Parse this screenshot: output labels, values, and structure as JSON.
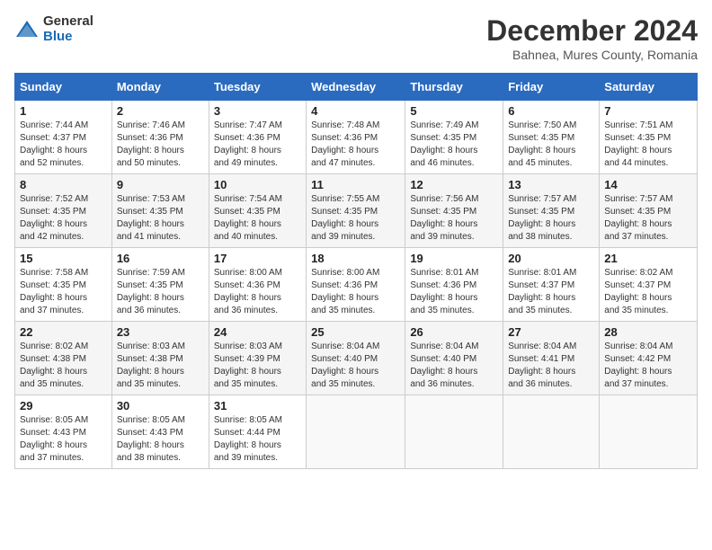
{
  "logo": {
    "general": "General",
    "blue": "Blue"
  },
  "title": "December 2024",
  "subtitle": "Bahnea, Mures County, Romania",
  "days_of_week": [
    "Sunday",
    "Monday",
    "Tuesday",
    "Wednesday",
    "Thursday",
    "Friday",
    "Saturday"
  ],
  "weeks": [
    [
      {
        "day": "1",
        "info": "Sunrise: 7:44 AM\nSunset: 4:37 PM\nDaylight: 8 hours\nand 52 minutes."
      },
      {
        "day": "2",
        "info": "Sunrise: 7:46 AM\nSunset: 4:36 PM\nDaylight: 8 hours\nand 50 minutes."
      },
      {
        "day": "3",
        "info": "Sunrise: 7:47 AM\nSunset: 4:36 PM\nDaylight: 8 hours\nand 49 minutes."
      },
      {
        "day": "4",
        "info": "Sunrise: 7:48 AM\nSunset: 4:36 PM\nDaylight: 8 hours\nand 47 minutes."
      },
      {
        "day": "5",
        "info": "Sunrise: 7:49 AM\nSunset: 4:35 PM\nDaylight: 8 hours\nand 46 minutes."
      },
      {
        "day": "6",
        "info": "Sunrise: 7:50 AM\nSunset: 4:35 PM\nDaylight: 8 hours\nand 45 minutes."
      },
      {
        "day": "7",
        "info": "Sunrise: 7:51 AM\nSunset: 4:35 PM\nDaylight: 8 hours\nand 44 minutes."
      }
    ],
    [
      {
        "day": "8",
        "info": "Sunrise: 7:52 AM\nSunset: 4:35 PM\nDaylight: 8 hours\nand 42 minutes."
      },
      {
        "day": "9",
        "info": "Sunrise: 7:53 AM\nSunset: 4:35 PM\nDaylight: 8 hours\nand 41 minutes."
      },
      {
        "day": "10",
        "info": "Sunrise: 7:54 AM\nSunset: 4:35 PM\nDaylight: 8 hours\nand 40 minutes."
      },
      {
        "day": "11",
        "info": "Sunrise: 7:55 AM\nSunset: 4:35 PM\nDaylight: 8 hours\nand 39 minutes."
      },
      {
        "day": "12",
        "info": "Sunrise: 7:56 AM\nSunset: 4:35 PM\nDaylight: 8 hours\nand 39 minutes."
      },
      {
        "day": "13",
        "info": "Sunrise: 7:57 AM\nSunset: 4:35 PM\nDaylight: 8 hours\nand 38 minutes."
      },
      {
        "day": "14",
        "info": "Sunrise: 7:57 AM\nSunset: 4:35 PM\nDaylight: 8 hours\nand 37 minutes."
      }
    ],
    [
      {
        "day": "15",
        "info": "Sunrise: 7:58 AM\nSunset: 4:35 PM\nDaylight: 8 hours\nand 37 minutes."
      },
      {
        "day": "16",
        "info": "Sunrise: 7:59 AM\nSunset: 4:35 PM\nDaylight: 8 hours\nand 36 minutes."
      },
      {
        "day": "17",
        "info": "Sunrise: 8:00 AM\nSunset: 4:36 PM\nDaylight: 8 hours\nand 36 minutes."
      },
      {
        "day": "18",
        "info": "Sunrise: 8:00 AM\nSunset: 4:36 PM\nDaylight: 8 hours\nand 35 minutes."
      },
      {
        "day": "19",
        "info": "Sunrise: 8:01 AM\nSunset: 4:36 PM\nDaylight: 8 hours\nand 35 minutes."
      },
      {
        "day": "20",
        "info": "Sunrise: 8:01 AM\nSunset: 4:37 PM\nDaylight: 8 hours\nand 35 minutes."
      },
      {
        "day": "21",
        "info": "Sunrise: 8:02 AM\nSunset: 4:37 PM\nDaylight: 8 hours\nand 35 minutes."
      }
    ],
    [
      {
        "day": "22",
        "info": "Sunrise: 8:02 AM\nSunset: 4:38 PM\nDaylight: 8 hours\nand 35 minutes."
      },
      {
        "day": "23",
        "info": "Sunrise: 8:03 AM\nSunset: 4:38 PM\nDaylight: 8 hours\nand 35 minutes."
      },
      {
        "day": "24",
        "info": "Sunrise: 8:03 AM\nSunset: 4:39 PM\nDaylight: 8 hours\nand 35 minutes."
      },
      {
        "day": "25",
        "info": "Sunrise: 8:04 AM\nSunset: 4:40 PM\nDaylight: 8 hours\nand 35 minutes."
      },
      {
        "day": "26",
        "info": "Sunrise: 8:04 AM\nSunset: 4:40 PM\nDaylight: 8 hours\nand 36 minutes."
      },
      {
        "day": "27",
        "info": "Sunrise: 8:04 AM\nSunset: 4:41 PM\nDaylight: 8 hours\nand 36 minutes."
      },
      {
        "day": "28",
        "info": "Sunrise: 8:04 AM\nSunset: 4:42 PM\nDaylight: 8 hours\nand 37 minutes."
      }
    ],
    [
      {
        "day": "29",
        "info": "Sunrise: 8:05 AM\nSunset: 4:43 PM\nDaylight: 8 hours\nand 37 minutes."
      },
      {
        "day": "30",
        "info": "Sunrise: 8:05 AM\nSunset: 4:43 PM\nDaylight: 8 hours\nand 38 minutes."
      },
      {
        "day": "31",
        "info": "Sunrise: 8:05 AM\nSunset: 4:44 PM\nDaylight: 8 hours\nand 39 minutes."
      },
      {
        "day": "",
        "info": ""
      },
      {
        "day": "",
        "info": ""
      },
      {
        "day": "",
        "info": ""
      },
      {
        "day": "",
        "info": ""
      }
    ]
  ]
}
